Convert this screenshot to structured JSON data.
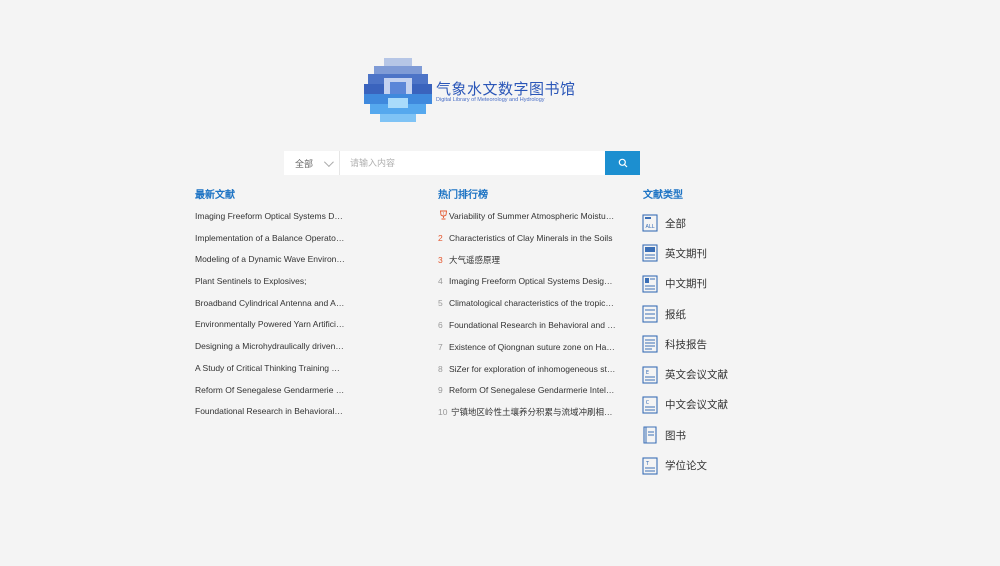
{
  "logo": {
    "title": "气象水文数字图书馆",
    "subtitle": "Digital Library of Meteorology and Hydrology"
  },
  "search": {
    "scope": "全部",
    "placeholder": "请输入内容",
    "value": "",
    "button_icon": "search-icon"
  },
  "latest": {
    "title": "最新文献",
    "items": [
      "Imaging Freeform Optical Systems Designed with NURBS Surfaces",
      "Implementation of a Balance Operator for Ensemble Data Assimilation",
      "Modeling of a Dynamic Wave Environment",
      "Plant Sentinels to Explosives;",
      "Broadband Cylindrical Antenna and Array",
      "Environmentally Powered Yarn Artificial Muscles",
      "Designing a Microhydraulically driven Actuator",
      "A Study of Critical Thinking Training Methods",
      "Reform Of Senegalese Gendarmerie Intelligence",
      "Foundational Research in Behavioral and Social Sciences"
    ]
  },
  "hot": {
    "title": "热门排行榜",
    "items": [
      {
        "rank": "1",
        "text": "Variability of Summer Atmospheric Moisture Flux"
      },
      {
        "rank": "2",
        "text": "Characteristics of Clay Minerals in the Soils"
      },
      {
        "rank": "3",
        "text": "大气遥感原理"
      },
      {
        "rank": "4",
        "text": "Imaging Freeform Optical Systems Designed with NURBS Surfaces"
      },
      {
        "rank": "5",
        "text": "Climatological characteristics of the tropical cyclones"
      },
      {
        "rank": "6",
        "text": "Foundational Research in Behavioral and Social Sciences"
      },
      {
        "rank": "7",
        "text": "Existence of Qiongnan suture zone on Hainan Island"
      },
      {
        "rank": "8",
        "text": "SiZer for exploration of inhomogeneous structures"
      },
      {
        "rank": "9",
        "text": "Reform Of Senegalese Gendarmerie Intelligence"
      },
      {
        "rank": "10",
        "text": "宁镇地区岭性土壤养分积累与流域冲刷相关性研究"
      }
    ]
  },
  "types": {
    "title": "文献类型",
    "items": [
      {
        "label": "全部",
        "icon": "all-docs-icon"
      },
      {
        "label": "英文期刊",
        "icon": "english-journal-icon"
      },
      {
        "label": "中文期刊",
        "icon": "chinese-journal-icon"
      },
      {
        "label": "报纸",
        "icon": "newspaper-icon"
      },
      {
        "label": "科技报告",
        "icon": "tech-report-icon"
      },
      {
        "label": "英文会议文献",
        "icon": "english-conference-icon"
      },
      {
        "label": "中文会议文献",
        "icon": "chinese-conference-icon"
      },
      {
        "label": "图书",
        "icon": "book-icon"
      },
      {
        "label": "学位论文",
        "icon": "thesis-icon"
      }
    ]
  },
  "colors": {
    "accent": "#1c8fd0",
    "heading": "#1c73c4",
    "rank_top": "#e4572e",
    "background": "#f4f4f4"
  }
}
